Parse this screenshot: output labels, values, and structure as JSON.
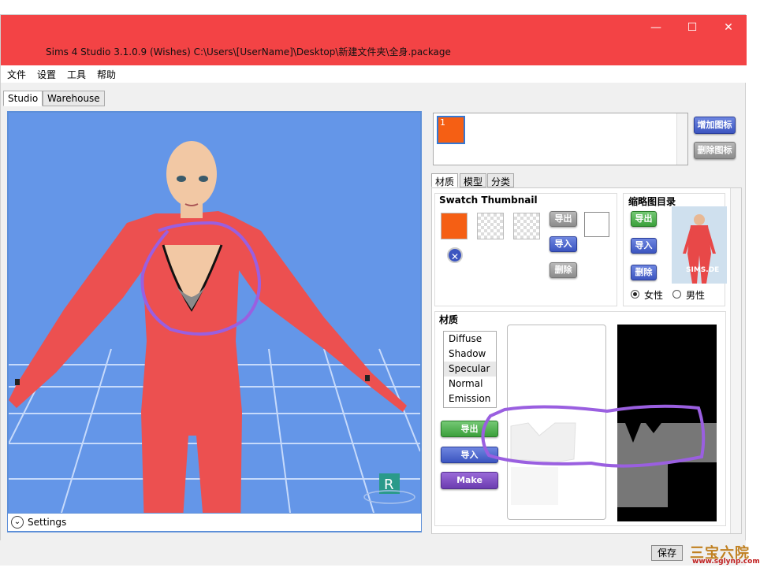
{
  "window": {
    "title": "Sims 4 Studio 3.1.0.9 (Wishes)  C:\\Users\\[UserName]\\Desktop\\新建文件夹\\全身.package",
    "minimize": "—",
    "maximize": "☐",
    "close": "✕"
  },
  "menu": {
    "items": [
      "文件",
      "设置",
      "工具",
      "帮助"
    ]
  },
  "main_tabs": [
    "Studio",
    "Warehouse"
  ],
  "viewport": {
    "settings_label": "Settings",
    "badge": "R"
  },
  "icon_list": {
    "selected_item": "1",
    "add_button": "增加图标",
    "remove_button": "删除图标"
  },
  "sub_tabs": [
    "材质",
    "模型",
    "分类"
  ],
  "swatch": {
    "title": "Swatch Thumbnail",
    "color": "#f55f14",
    "export_button": "导出",
    "import_button": "导入",
    "delete_button": "删除"
  },
  "catalog": {
    "title": "缩略图目录",
    "export_button": "导出",
    "import_button": "导入",
    "delete_button": "删除",
    "female_label": "女性",
    "male_label": "男性",
    "thumb_text": "SIMS.DE"
  },
  "material": {
    "title": "材质",
    "items": [
      "Diffuse",
      "Shadow",
      "Specular",
      "Normal",
      "Emission"
    ],
    "export_button": "导出",
    "import_button": "导入",
    "blank_button": "Make Blank"
  },
  "footer": {
    "save_button": "保存",
    "watermark_logo": "三宝六院",
    "watermark_url": "www.sglynp.com"
  },
  "colors": {
    "titlebar": "#f34345",
    "viewport_bg": "#6496e8",
    "accent": "#3c55c0",
    "annotation": "#9a5fe0"
  }
}
